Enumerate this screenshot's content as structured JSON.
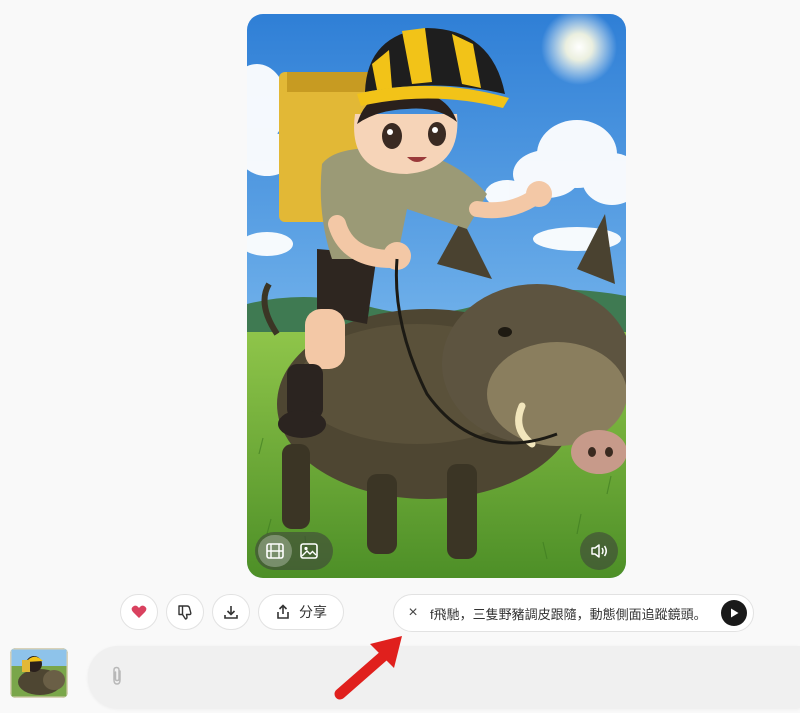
{
  "media": {
    "subject": "anime girl in yellow-black helmet riding a wild boar across a grassy field",
    "view_mode_icons": [
      "film-icon",
      "image-icon"
    ],
    "active_mode": "film",
    "sound_icon": "speaker-icon"
  },
  "actions": {
    "like_icon": "heart-icon",
    "dislike_icon": "thumbs-down-icon",
    "download_icon": "download-icon",
    "share_label": "分享"
  },
  "prompt_chip": {
    "close_glyph": "×",
    "text": "f飛馳，三隻野豬調皮跟隨，動態側面追蹤鏡頭。",
    "play_icon": "play-icon"
  },
  "composer": {
    "attach_icon": "paperclip-icon"
  },
  "colors": {
    "heart": "#d9415f",
    "arrow": "#e0201d",
    "play_bg": "#1a1a1a"
  }
}
